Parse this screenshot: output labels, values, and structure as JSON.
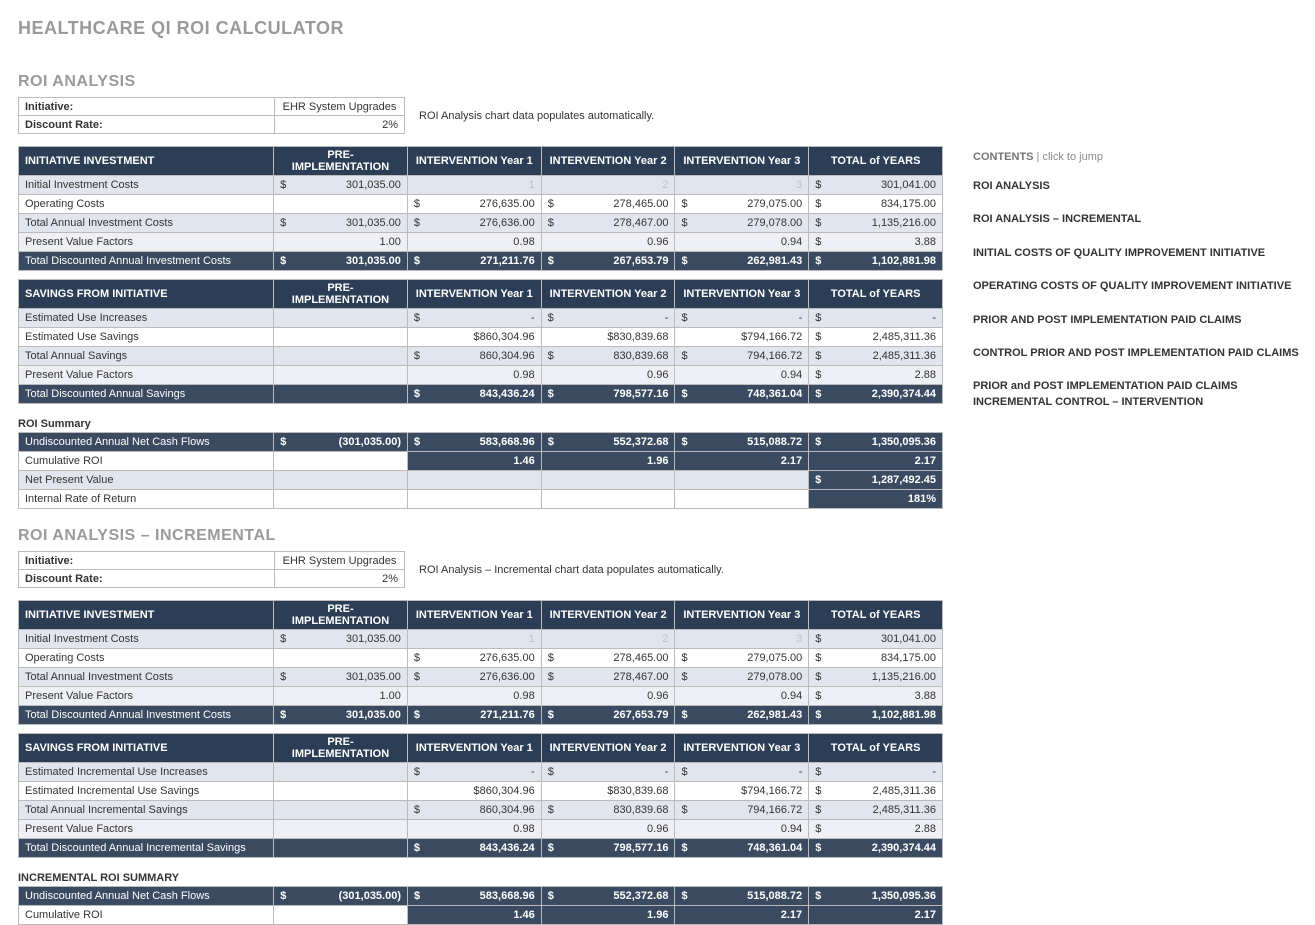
{
  "title": "HEALTHCARE QI ROI CALCULATOR",
  "section1": {
    "heading": "ROI ANALYSIS",
    "initiative_label": "Initiative:",
    "initiative_value": "EHR System Upgrades",
    "discount_label": "Discount Rate:",
    "discount_value": "2%",
    "note": "ROI Analysis chart data populates automatically.",
    "cols": [
      "INITIATIVE INVESTMENT",
      "PRE-IMPLEMENTATION",
      "INTERVENTION Year 1",
      "INTERVENTION Year 2",
      "INTERVENTION Year 3",
      "TOTAL of YEARS"
    ],
    "r1": {
      "l": "Initial Investment Costs",
      "a": "301,035.00",
      "b": "1",
      "c": "2",
      "d": "3",
      "e": "301,041.00"
    },
    "r2": {
      "l": "Operating Costs",
      "b": "276,635.00",
      "c": "278,465.00",
      "d": "279,075.00",
      "e": "834,175.00"
    },
    "r3": {
      "l": "Total Annual Investment Costs",
      "a": "301,035.00",
      "b": "276,636.00",
      "c": "278,467.00",
      "d": "279,078.00",
      "e": "1,135,216.00"
    },
    "r4": {
      "l": "Present Value Factors",
      "a": "1.00",
      "b": "0.98",
      "c": "0.96",
      "d": "0.94",
      "e": "3.88"
    },
    "r5": {
      "l": "Total Discounted Annual Investment Costs",
      "a": "301,035.00",
      "b": "271,211.76",
      "c": "267,653.79",
      "d": "262,981.43",
      "e": "1,102,881.98"
    },
    "savcols": [
      "SAVINGS FROM INITIATIVE",
      "PRE-IMPLEMENTATION",
      "INTERVENTION Year 1",
      "INTERVENTION Year 2",
      "INTERVENTION Year 3",
      "TOTAL of YEARS"
    ],
    "s1": {
      "l": "Estimated Use Increases",
      "b": "-",
      "c": "-",
      "d": "-",
      "e": "-"
    },
    "s2": {
      "l": "Estimated Use Savings",
      "b": "$860,304.96",
      "c": "$830,839.68",
      "d": "$794,166.72",
      "e": "2,485,311.36"
    },
    "s3": {
      "l": "Total Annual Savings",
      "b": "860,304.96",
      "c": "830,839.68",
      "d": "794,166.72",
      "e": "2,485,311.36"
    },
    "s4": {
      "l": "Present Value Factors",
      "b": "0.98",
      "c": "0.96",
      "d": "0.94",
      "e": "2.88"
    },
    "s5": {
      "l": "Total Discounted Annual Savings",
      "b": "843,436.24",
      "c": "798,577.16",
      "d": "748,361.04",
      "e": "2,390,374.44"
    },
    "sumhdr": "ROI Summary",
    "m1": {
      "l": "Undiscounted Annual Net Cash Flows",
      "a": "(301,035.00)",
      "b": "583,668.96",
      "c": "552,372.68",
      "d": "515,088.72",
      "e": "1,350,095.36"
    },
    "m2": {
      "l": "Cumulative ROI",
      "b": "1.46",
      "c": "1.96",
      "d": "2.17",
      "e": "2.17"
    },
    "m3": {
      "l": "Net Present Value",
      "e": "1,287,492.45"
    },
    "m4": {
      "l": "Internal Rate of Return",
      "e": "181%"
    }
  },
  "section2": {
    "heading": "ROI ANALYSIS – INCREMENTAL",
    "initiative_label": "Initiative:",
    "initiative_value": "EHR System Upgrades",
    "discount_label": "Discount Rate:",
    "discount_value": "2%",
    "note": "ROI Analysis – Incremental chart data populates automatically.",
    "cols": [
      "INITIATIVE INVESTMENT",
      "PRE-IMPLEMENTATION",
      "INTERVENTION Year 1",
      "INTERVENTION Year 2",
      "INTERVENTION Year 3",
      "TOTAL of YEARS"
    ],
    "r1": {
      "l": "Initial Investment Costs",
      "a": "301,035.00",
      "b": "1",
      "c": "2",
      "d": "3",
      "e": "301,041.00"
    },
    "r2": {
      "l": "Operating Costs",
      "b": "276,635.00",
      "c": "278,465.00",
      "d": "279,075.00",
      "e": "834,175.00"
    },
    "r3": {
      "l": "Total Annual Investment Costs",
      "a": "301,035.00",
      "b": "276,636.00",
      "c": "278,467.00",
      "d": "279,078.00",
      "e": "1,135,216.00"
    },
    "r4": {
      "l": "Present Value Factors",
      "a": "1.00",
      "b": "0.98",
      "c": "0.96",
      "d": "0.94",
      "e": "3.88"
    },
    "r5": {
      "l": "Total Discounted Annual Investment Costs",
      "a": "301,035.00",
      "b": "271,211.76",
      "c": "267,653.79",
      "d": "262,981.43",
      "e": "1,102,881.98"
    },
    "savcols": [
      "SAVINGS FROM INITIATIVE",
      "PRE-IMPLEMENTATION",
      "INTERVENTION Year 1",
      "INTERVENTION Year 2",
      "INTERVENTION Year 3",
      "TOTAL of YEARS"
    ],
    "s1": {
      "l": "Estimated Incremental Use Increases",
      "b": "-",
      "c": "-",
      "d": "-",
      "e": "-"
    },
    "s2": {
      "l": "Estimated Incremental Use Savings",
      "b": "$860,304.96",
      "c": "$830,839.68",
      "d": "$794,166.72",
      "e": "2,485,311.36"
    },
    "s3": {
      "l": "Total Annual Incremental Savings",
      "b": "860,304.96",
      "c": "830,839.68",
      "d": "794,166.72",
      "e": "2,485,311.36"
    },
    "s4": {
      "l": "Present Value Factors",
      "b": "0.98",
      "c": "0.96",
      "d": "0.94",
      "e": "2.88"
    },
    "s5": {
      "l": "Total Discounted Annual Incremental Savings",
      "b": "843,436.24",
      "c": "798,577.16",
      "d": "748,361.04",
      "e": "2,390,374.44"
    },
    "sumhdr": "INCREMENTAL ROI SUMMARY",
    "m1": {
      "l": "Undiscounted Annual Net Cash Flows",
      "a": "(301,035.00)",
      "b": "583,668.96",
      "c": "552,372.68",
      "d": "515,088.72",
      "e": "1,350,095.36"
    },
    "m2": {
      "l": "Cumulative ROI",
      "b": "1.46",
      "c": "1.96",
      "d": "2.17",
      "e": "2.17"
    }
  },
  "toc": {
    "hdr_bold": "CONTENTS",
    "hdr_rest": " |  click to jump",
    "items": [
      "ROI ANALYSIS",
      "ROI ANALYSIS – INCREMENTAL",
      "INITIAL COSTS OF QUALITY IMPROVEMENT INITIATIVE",
      "OPERATING COSTS OF QUALITY IMPROVEMENT INITIATIVE",
      "PRIOR AND POST IMPLEMENTATION PAID CLAIMS",
      "CONTROL PRIOR AND POST IMPLEMENTATION PAID CLAIMS",
      "PRIOR and POST IMPLEMENTATION PAID CLAIMS INCREMENTAL CONTROL – INTERVENTION"
    ]
  }
}
